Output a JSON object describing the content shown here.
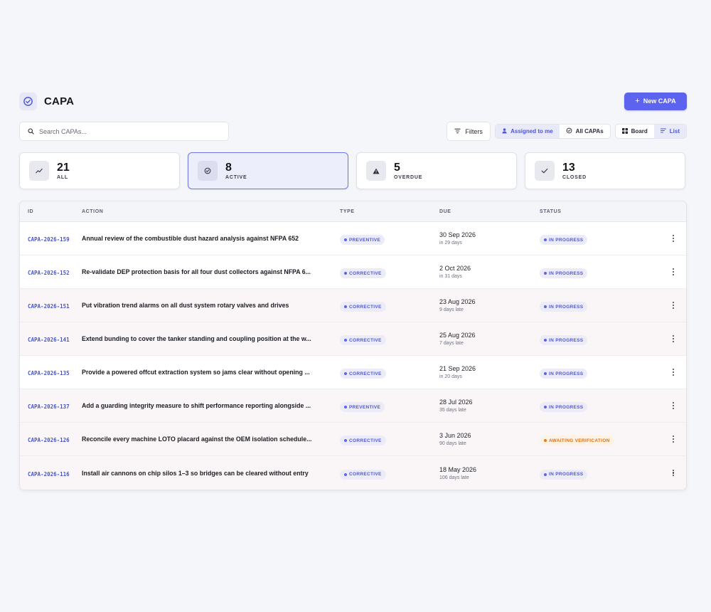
{
  "header": {
    "title": "CAPA",
    "new_button": "New CAPA"
  },
  "toolbar": {
    "search_placeholder": "Search CAPAs...",
    "filters": "Filters",
    "scope": [
      "Assigned to me",
      "All CAPAs"
    ],
    "scope_selected": "Assigned to me",
    "views": [
      "Board",
      "List"
    ],
    "view_selected": "List"
  },
  "stats": [
    {
      "count": "21",
      "label": "ALL",
      "icon": "trend-icon"
    },
    {
      "count": "8",
      "label": "ACTIVE",
      "icon": "check-circle-icon",
      "selected": true
    },
    {
      "count": "5",
      "label": "OVERDUE",
      "icon": "warning-icon"
    },
    {
      "count": "13",
      "label": "CLOSED",
      "icon": "check-icon"
    }
  ],
  "table": {
    "columns": [
      "ID",
      "ACTION",
      "TYPE",
      "DUE",
      "STATUS"
    ],
    "rows": [
      {
        "id": "CAPA-2026-159",
        "action": "Annual review of the combustible dust hazard analysis against NFPA 652",
        "type": "PREVENTIVE",
        "due": "30 Sep 2026",
        "due_note": "in 29 days",
        "status": "IN PROGRESS",
        "overdue": false
      },
      {
        "id": "CAPA-2026-152",
        "action": "Re-validate DEP protection basis for all four dust collectors against NFPA 6...",
        "type": "CORRECTIVE",
        "due": "2 Oct 2026",
        "due_note": "in 31 days",
        "status": "IN PROGRESS",
        "overdue": false
      },
      {
        "id": "CAPA-2026-151",
        "action": "Put vibration trend alarms on all dust system rotary valves and drives",
        "type": "CORRECTIVE",
        "due": "23 Aug 2026",
        "due_note": "9 days late",
        "status": "IN PROGRESS",
        "overdue": true
      },
      {
        "id": "CAPA-2026-141",
        "action": "Extend bunding to cover the tanker standing and coupling position at the w...",
        "type": "CORRECTIVE",
        "due": "25 Aug 2026",
        "due_note": "7 days late",
        "status": "IN PROGRESS",
        "overdue": true
      },
      {
        "id": "CAPA-2026-135",
        "action": "Provide a powered offcut extraction system so jams clear without opening ...",
        "type": "CORRECTIVE",
        "due": "21 Sep 2026",
        "due_note": "in 20 days",
        "status": "IN PROGRESS",
        "overdue": false
      },
      {
        "id": "CAPA-2026-137",
        "action": "Add a guarding integrity measure to shift performance reporting alongside ...",
        "type": "PREVENTIVE",
        "due": "28 Jul 2026",
        "due_note": "35 days late",
        "status": "IN PROGRESS",
        "overdue": true
      },
      {
        "id": "CAPA-2026-126",
        "action": "Reconcile every machine LOTO placard against the OEM isolation schedule...",
        "type": "CORRECTIVE",
        "due": "3 Jun 2026",
        "due_note": "90 days late",
        "status": "AWAITING VERIFICATION",
        "overdue": true
      },
      {
        "id": "CAPA-2026-116",
        "action": "Install air cannons on chip silos 1–3 so bridges can be cleared without entry",
        "type": "CORRECTIVE",
        "due": "18 May 2026",
        "due_note": "106 days late",
        "status": "IN PROGRESS",
        "overdue": true
      }
    ]
  }
}
